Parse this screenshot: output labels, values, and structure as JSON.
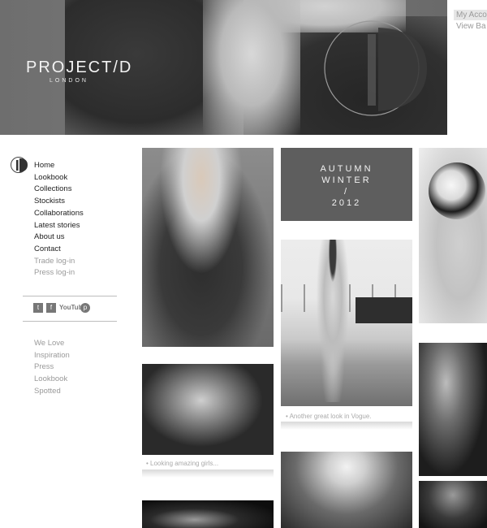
{
  "brand": {
    "name": "PROJECT/D",
    "subtitle": "LONDON"
  },
  "header_links": {
    "account": "My Acco",
    "bag": "View Ba"
  },
  "nav": {
    "main": [
      "Home",
      "Lookbook",
      "Collections",
      "Stockists",
      "Collaborations",
      "Latest stories",
      "About us",
      "Contact"
    ],
    "secondary": [
      "Trade log-in",
      "Press log-in"
    ]
  },
  "social": {
    "twitter": "t",
    "facebook": "f",
    "youtube": "YouTube",
    "pinterest": "p"
  },
  "sidebar_links": [
    "We Love",
    "Inspiration",
    "Press",
    "Lookbook",
    "Spotted"
  ],
  "season_tile": {
    "line1": "AUTUMN",
    "line2": "WINTER",
    "line3": "/",
    "line4": "2012"
  },
  "captions": {
    "twins": "• Looking amazing girls...",
    "beach": "• Another great look in Vogue."
  },
  "colors": {
    "season_tile_bg": "#5e5e5e",
    "nav_active": "#222222",
    "nav_dim": "#9a9a9a"
  }
}
